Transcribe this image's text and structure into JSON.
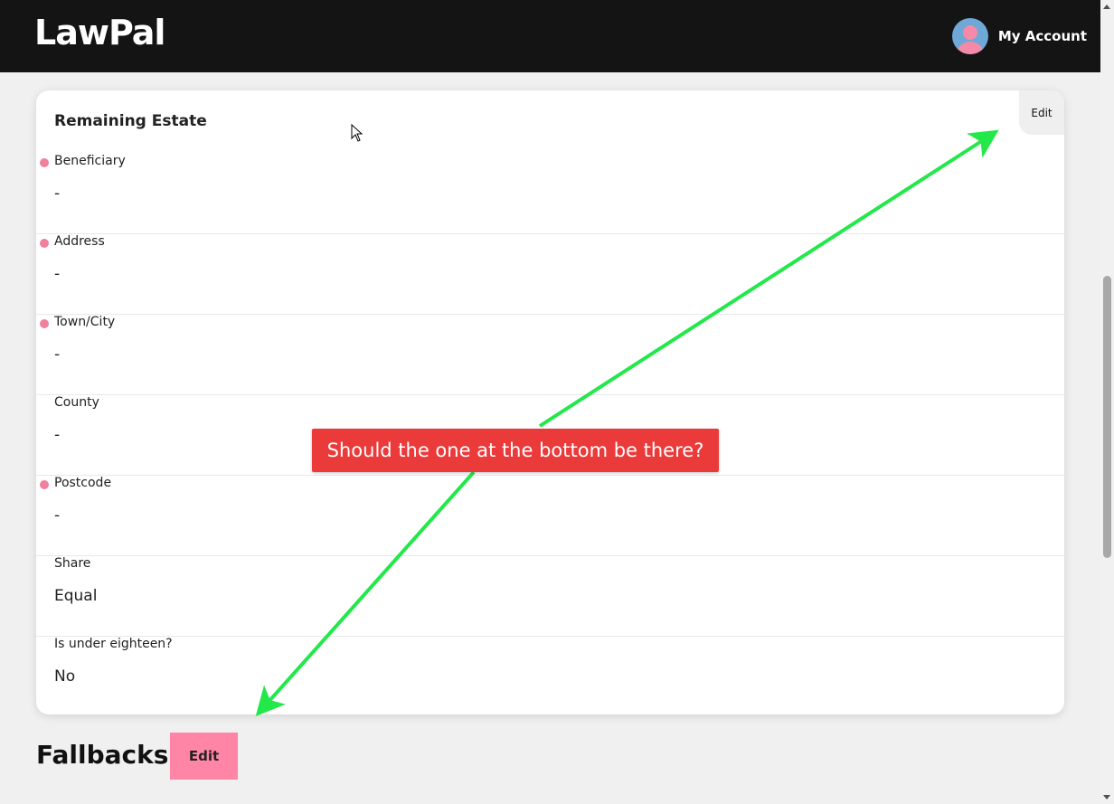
{
  "header": {
    "logo": "LawPal",
    "account_label": "My Account"
  },
  "card": {
    "title": "Remaining Estate",
    "edit_label": "Edit",
    "fields": [
      {
        "label": "Beneficiary",
        "value": "-",
        "required": true
      },
      {
        "label": "Address",
        "value": "-",
        "required": true
      },
      {
        "label": "Town/City",
        "value": "-",
        "required": true
      },
      {
        "label": "County",
        "value": "-",
        "required": false
      },
      {
        "label": "Postcode",
        "value": "-",
        "required": true
      },
      {
        "label": "Share",
        "value": "Equal",
        "required": false
      },
      {
        "label": "Is under eighteen?",
        "value": "No",
        "required": false
      }
    ]
  },
  "fallbacks": {
    "title": "Fallbacks",
    "edit_label": "Edit"
  },
  "annotation": {
    "callout_text": "Should the one at the bottom be there?"
  },
  "colors": {
    "header_bg": "#141414",
    "required_dot": "#f07fa0",
    "fallbacks_button": "#ff85a6",
    "callout_bg": "#ea3a3a",
    "arrow": "#22e84a"
  }
}
